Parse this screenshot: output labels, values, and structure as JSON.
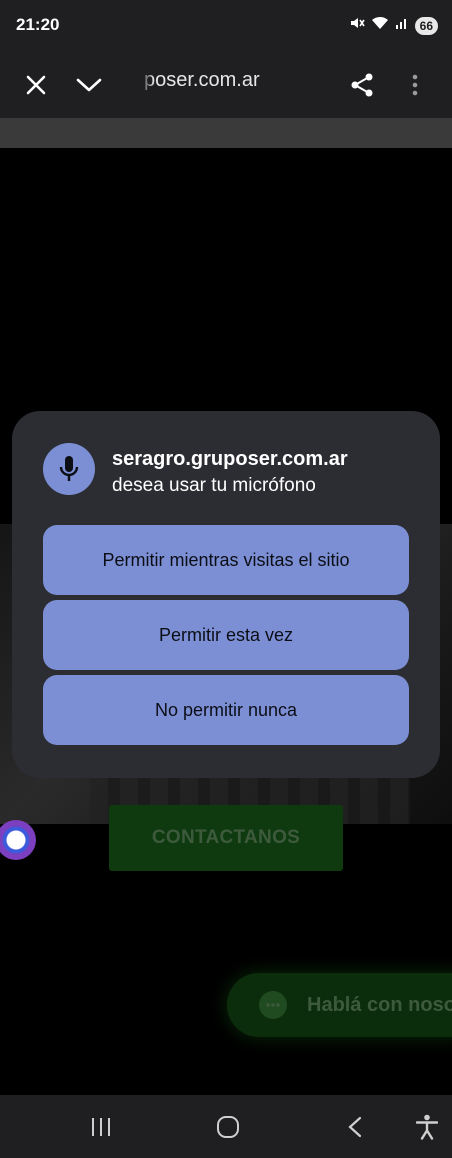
{
  "status_bar": {
    "time": "21:20",
    "battery": "66",
    "icons": [
      "mute-icon",
      "wifi-icon",
      "signal-icon",
      "battery-icon"
    ]
  },
  "browser": {
    "url": "poser.com.ar",
    "icons": [
      "close-icon",
      "chevron-down-icon",
      "share-icon",
      "more-vert-icon"
    ]
  },
  "page": {
    "contact_button": "CONTACTANOS",
    "chat_label": "Hablá con noso"
  },
  "dialog": {
    "site": "seragro.gruposer.com.ar",
    "message": "desea usar tu micrófono",
    "buttons": {
      "allow_while_visiting": "Permitir mientras visitas el sitio",
      "allow_once": "Permitir esta vez",
      "never_allow": "No permitir nunca"
    },
    "accent_color": "#7c8fd4",
    "background_color": "#2c2d33"
  },
  "nav_bar": {
    "icons": [
      "recents-icon",
      "home-icon",
      "back-icon",
      "accessibility-icon"
    ]
  }
}
